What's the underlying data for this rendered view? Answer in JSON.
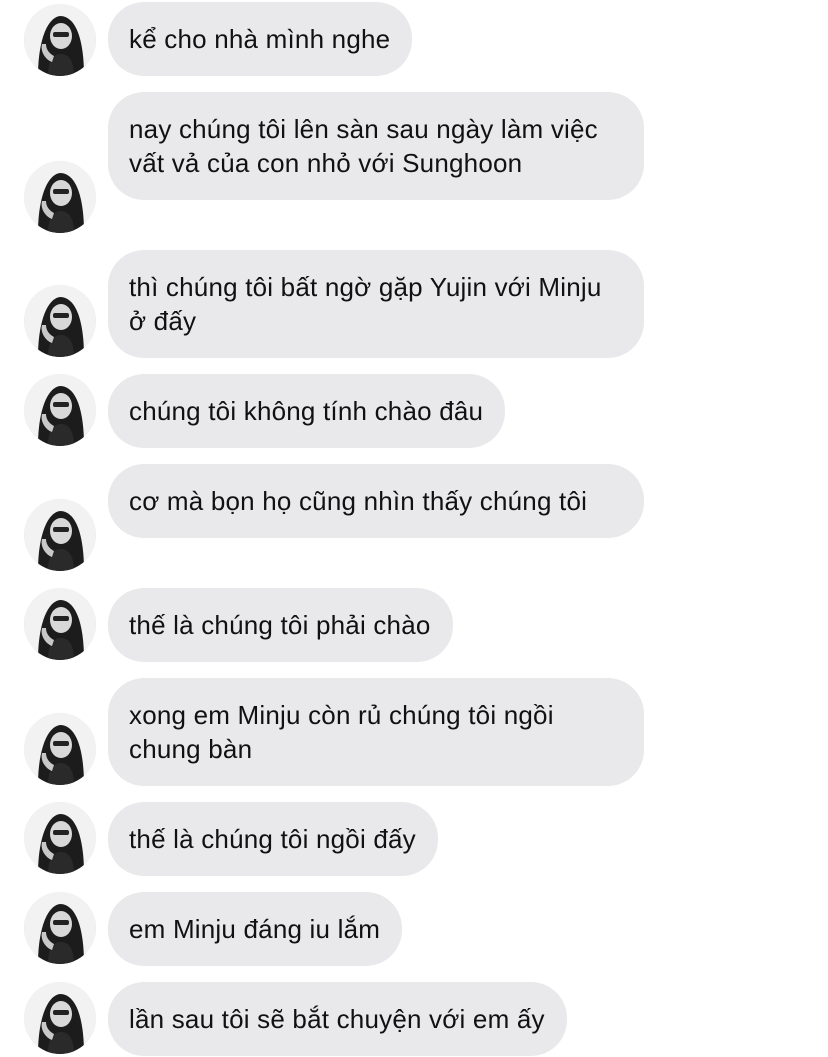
{
  "conversation": {
    "messages": [
      {
        "text": "kể cho nhà mình nghe"
      },
      {
        "text": "nay chúng tôi lên sàn sau ngày làm việc vất vả của con nhỏ với Sunghoon"
      },
      {
        "text": "thì chúng tôi bất ngờ gặp Yujin với Minju ở đấy"
      },
      {
        "text": "chúng tôi không tính chào đâu"
      },
      {
        "text": "cơ mà bọn họ cũng nhìn thấy chúng tôi"
      },
      {
        "text": "thế là chúng tôi phải chào"
      },
      {
        "text": "xong em Minju còn rủ chúng tôi ngồi chung bàn"
      },
      {
        "text": "thế là chúng tôi ngồi đấy"
      },
      {
        "text": "em Minju đáng iu lắm"
      },
      {
        "text": "lần sau tôi sẽ bắt chuyện với em ấy"
      }
    ]
  },
  "colors": {
    "bubble_bg": "#e9e9eb",
    "text": "#111111",
    "background": "#ffffff"
  },
  "icons": {
    "avatar": "avatar-photo-icon"
  }
}
